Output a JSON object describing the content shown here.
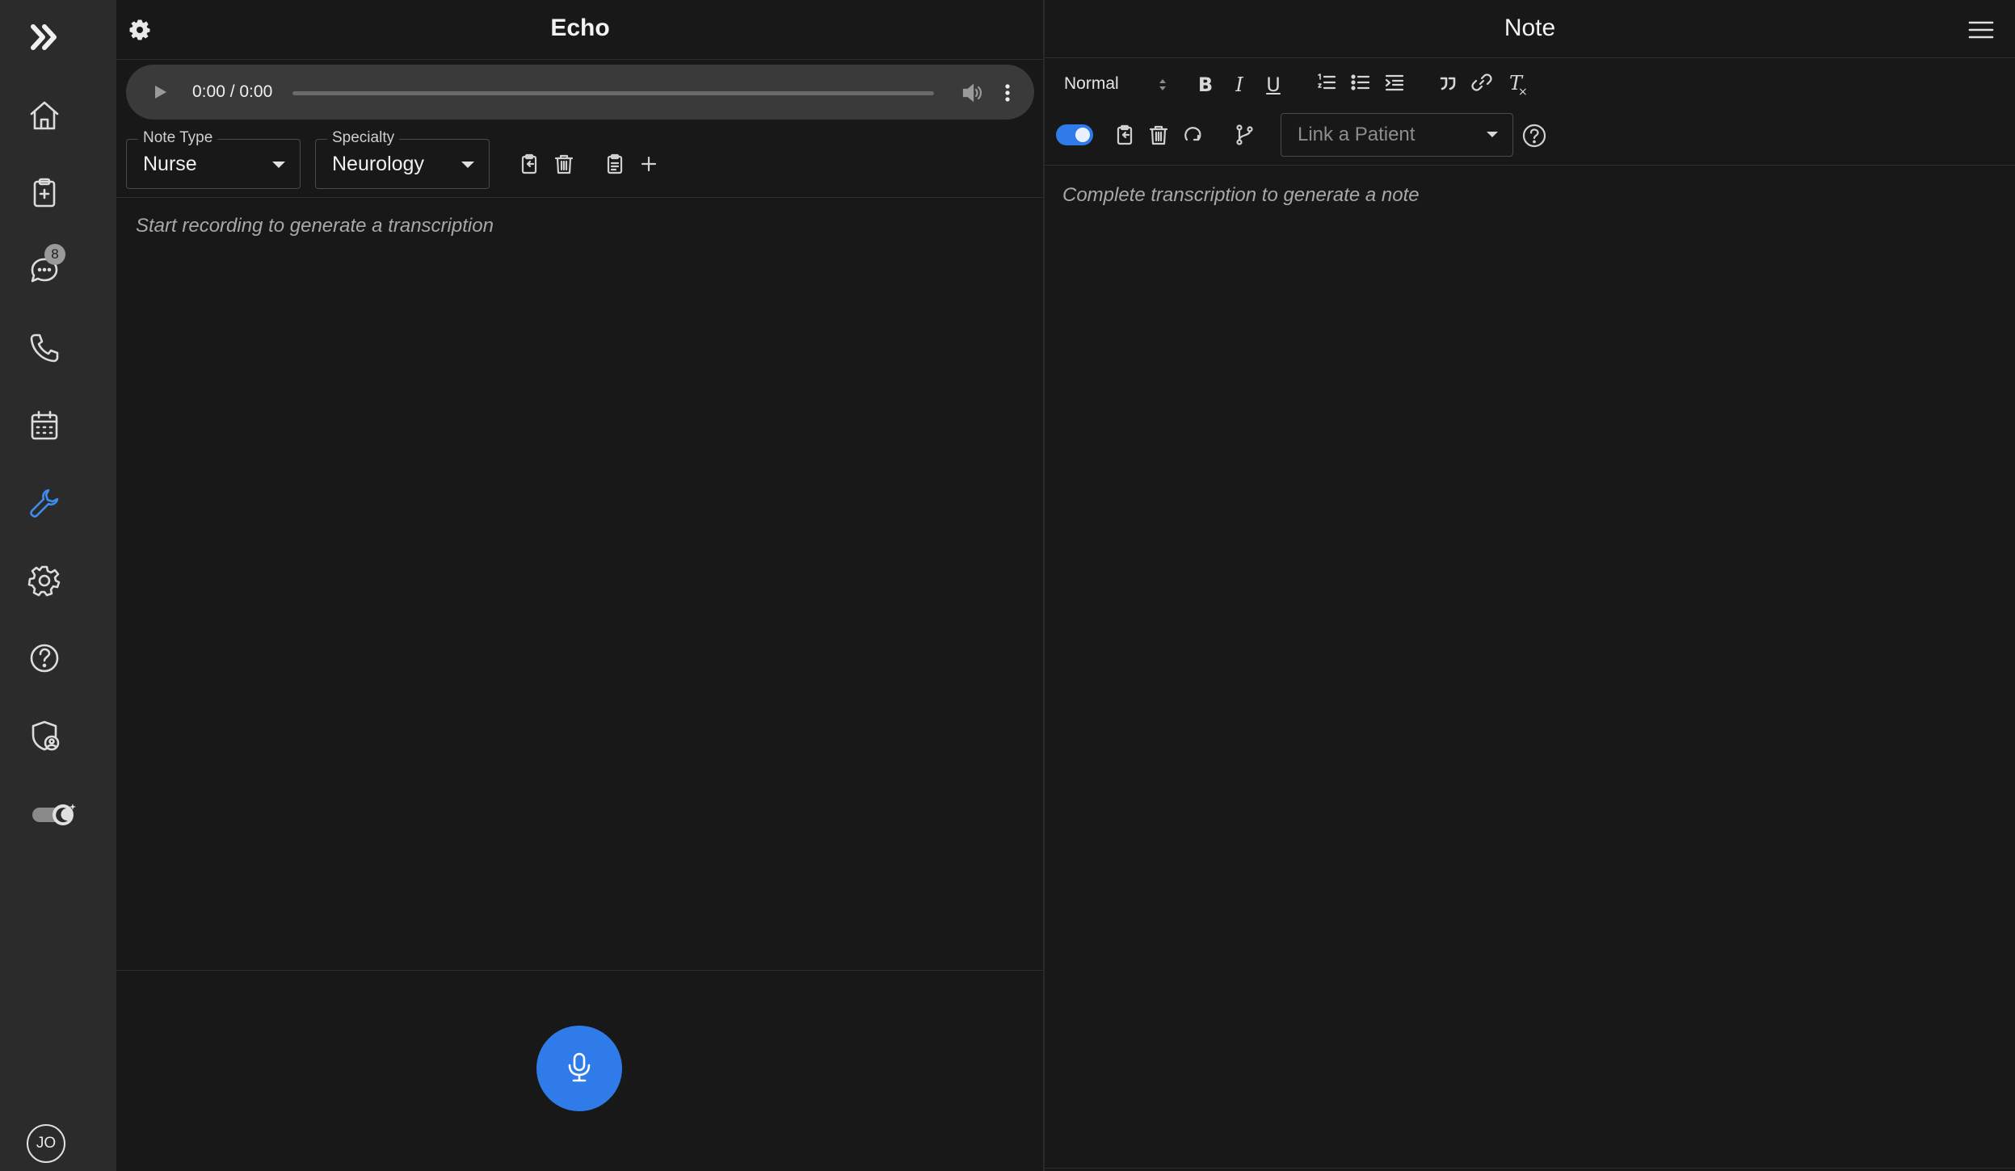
{
  "sidebar": {
    "items": [
      {
        "name": "expand",
        "icon": "double-chevron-right-icon"
      },
      {
        "name": "home",
        "icon": "home-icon"
      },
      {
        "name": "clipboard",
        "icon": "clipboard-plus-icon"
      },
      {
        "name": "messages",
        "icon": "chat-icon",
        "badge": "8"
      },
      {
        "name": "calls",
        "icon": "phone-icon"
      },
      {
        "name": "calendar",
        "icon": "calendar-icon"
      },
      {
        "name": "tools",
        "icon": "wrench-icon",
        "active": true
      },
      {
        "name": "settings",
        "icon": "gear-icon"
      },
      {
        "name": "help",
        "icon": "help-circle-icon"
      },
      {
        "name": "security",
        "icon": "shield-user-icon"
      },
      {
        "name": "theme",
        "icon": "theme-toggle-icon"
      }
    ],
    "avatar_initials": "JO",
    "accent_color": "#3d8cf0"
  },
  "echo": {
    "title": "Echo",
    "audio": {
      "time": "0:00 / 0:00"
    },
    "note_type": {
      "label": "Note Type",
      "value": "Nurse"
    },
    "specialty": {
      "label": "Specialty",
      "value": "Neurology"
    },
    "transcript_placeholder": "Start recording to generate a transcription"
  },
  "note": {
    "title": "Note",
    "format_select": "Normal",
    "toolbar": {
      "bold": "B",
      "italic": "I",
      "underline": "U",
      "clear_format": "T"
    },
    "patient_placeholder": "Link a Patient",
    "note_placeholder": "Complete transcription to generate a note"
  },
  "colors": {
    "background": "#181818",
    "sidebar": "#2b2b2c",
    "primary": "#2f7bea"
  }
}
